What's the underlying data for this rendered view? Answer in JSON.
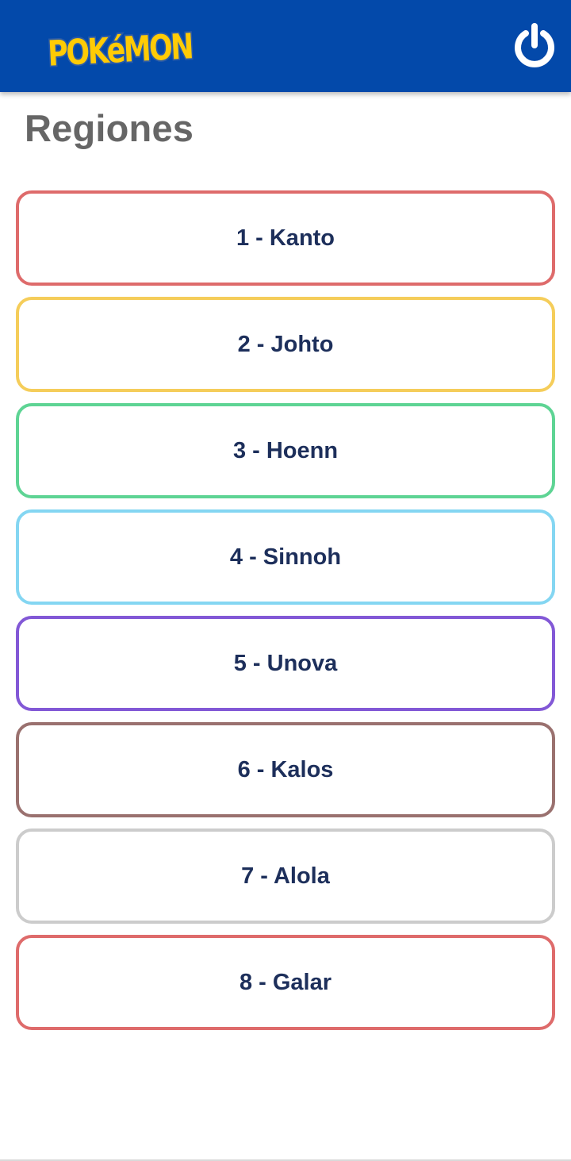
{
  "header": {
    "logo_text": "POKéMON",
    "logo_colors": {
      "fill": "#ffcb05",
      "outline": "#2a5aa8"
    },
    "background_color": "#0349aa",
    "power_icon": "power-icon"
  },
  "page": {
    "title": "Regiones"
  },
  "regions": [
    {
      "label": "1 - Kanto",
      "border_color": "#de6b6b"
    },
    {
      "label": "2 - Johto",
      "border_color": "#f5cd5a"
    },
    {
      "label": "3 - Hoenn",
      "border_color": "#5ed494"
    },
    {
      "label": "4 - Sinnoh",
      "border_color": "#84d6f2"
    },
    {
      "label": "5 - Unova",
      "border_color": "#8258d6"
    },
    {
      "label": "6 - Kalos",
      "border_color": "#9a716f"
    },
    {
      "label": "7 - Alola",
      "border_color": "#cccccc"
    },
    {
      "label": "8 - Galar",
      "border_color": "#de6b6b"
    }
  ]
}
